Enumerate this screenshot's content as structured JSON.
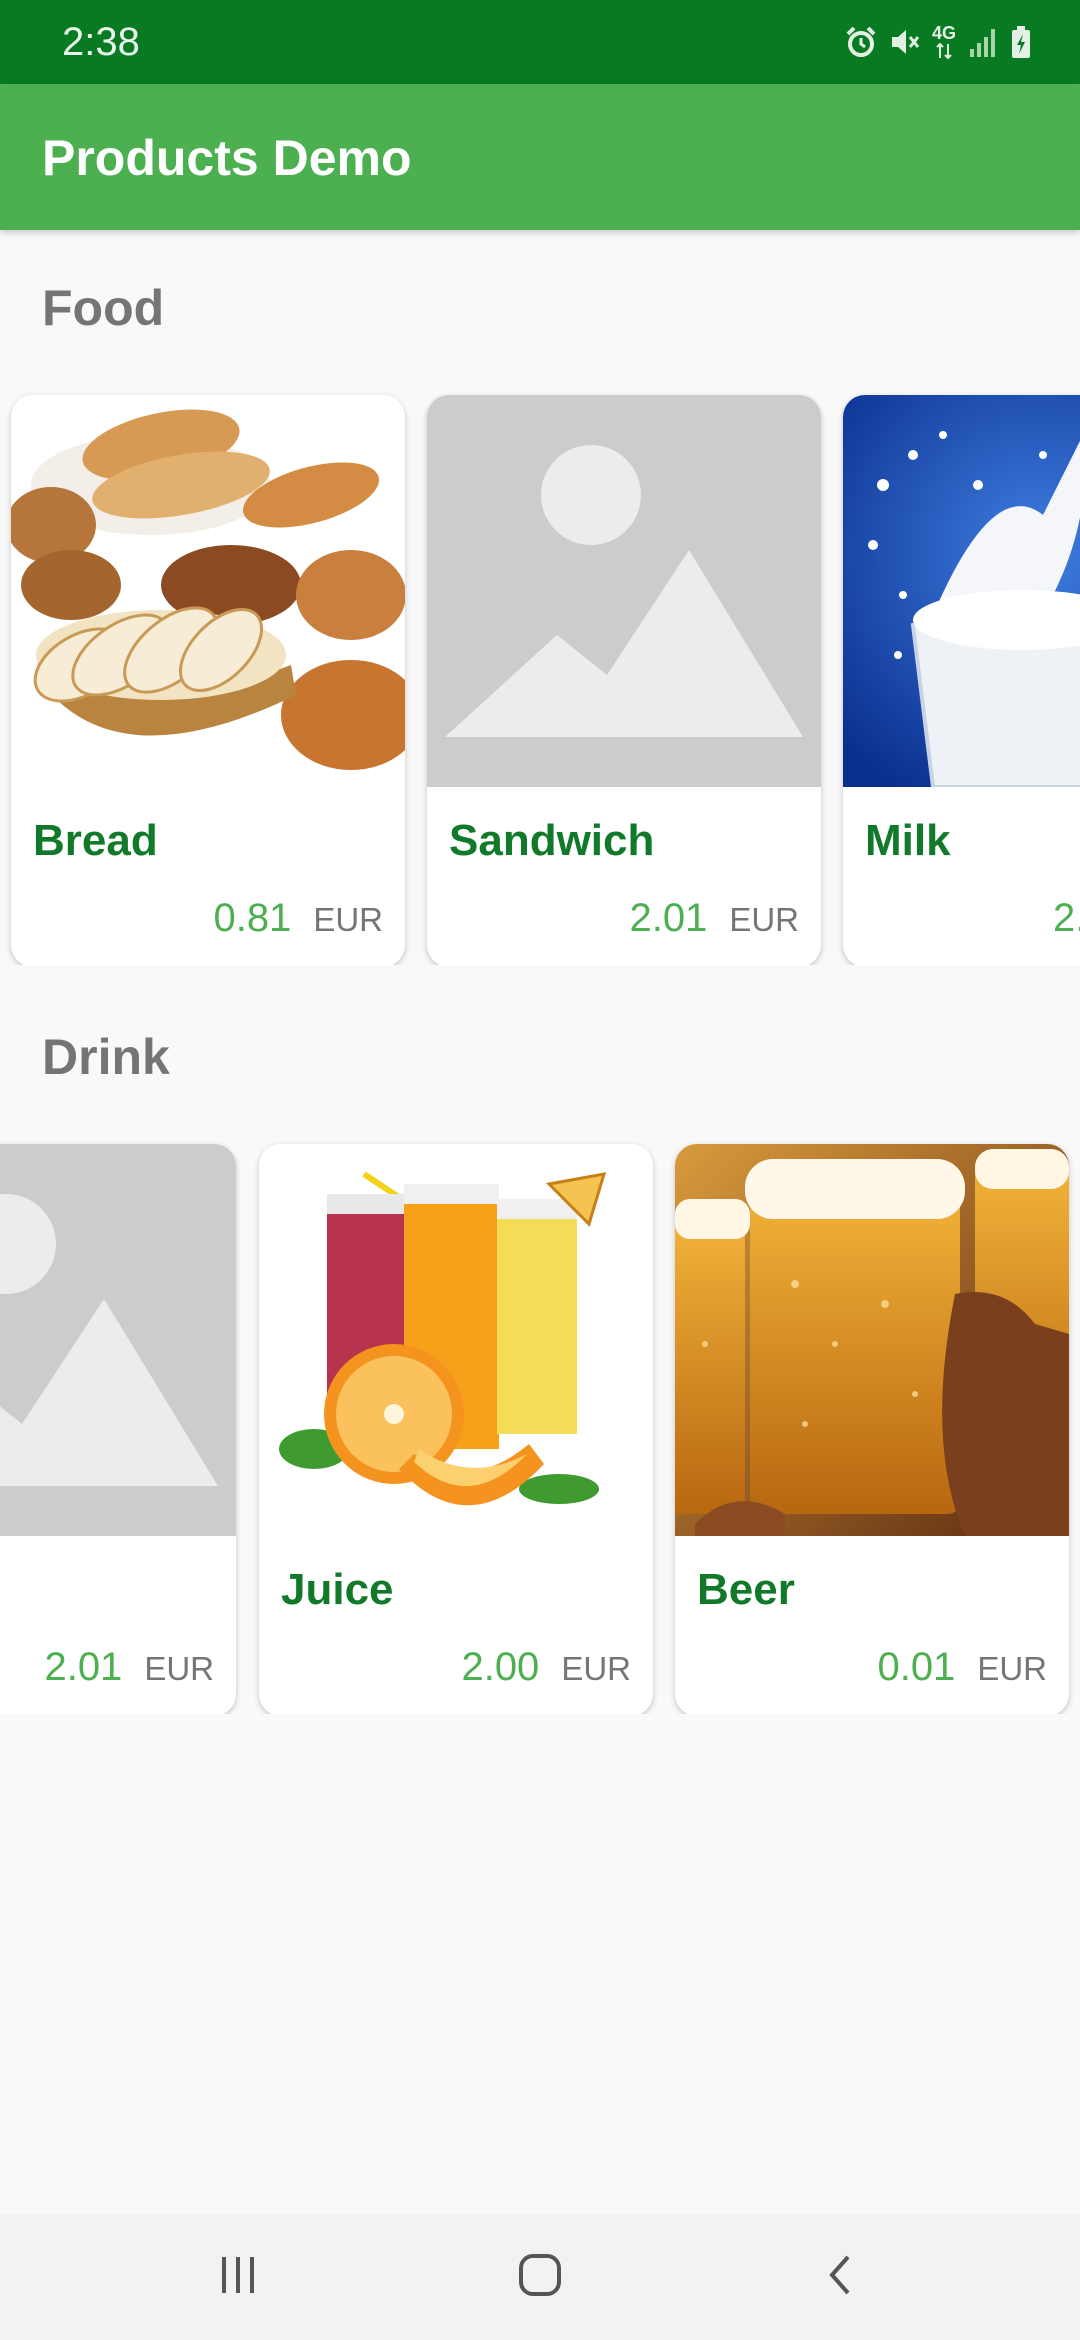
{
  "status_bar": {
    "time": "2:38",
    "network_label": "4G",
    "icons": [
      "alarm-icon",
      "vibrate-mute-icon",
      "network-4g-icon",
      "signal-icon",
      "battery-charging-icon"
    ]
  },
  "app_bar": {
    "title": "Products Demo"
  },
  "sections": [
    {
      "title": "Food",
      "products": [
        {
          "name": "Bread",
          "price": "0.81",
          "currency": "EUR",
          "image": "bread-photo"
        },
        {
          "name": "Sandwich",
          "price": "2.01",
          "currency": "EUR",
          "image": "placeholder-image-icon"
        },
        {
          "name": "Milk",
          "price": "2.",
          "currency": "",
          "image": "milk-photo"
        }
      ]
    },
    {
      "title": "Drink",
      "products": [
        {
          "name": "",
          "price": "2.01",
          "currency": "EUR",
          "image": "placeholder-image-icon"
        },
        {
          "name": "Juice",
          "price": "2.00",
          "currency": "EUR",
          "image": "juice-photo"
        },
        {
          "name": "Beer",
          "price": "0.01",
          "currency": "EUR",
          "image": "beer-photo"
        }
      ]
    }
  ],
  "nav_bar": {
    "buttons": [
      "recent-apps-icon",
      "home-icon",
      "back-icon"
    ]
  },
  "colors": {
    "status_bar": "#077a22",
    "app_bar": "#4caf50",
    "product_name": "#11792a",
    "price": "#4caf50",
    "section_title": "#757575",
    "placeholder": "#cccccc"
  }
}
